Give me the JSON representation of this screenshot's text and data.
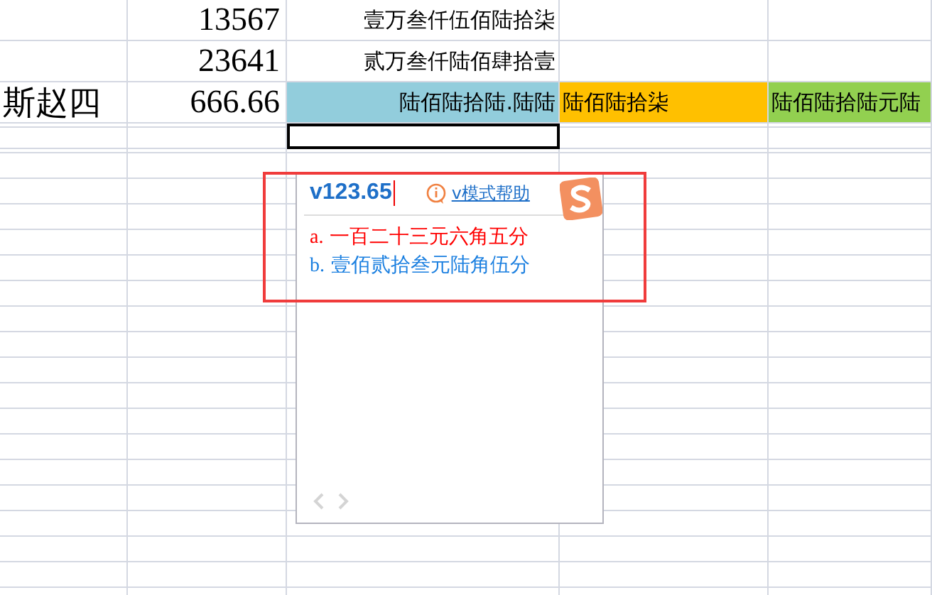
{
  "sheet": {
    "rows": [
      {
        "cells": [
          {
            "selected": false
          },
          {
            "text": "13567",
            "selected": false
          },
          {
            "text": "壹万叁仟伍佰陆拾柒",
            "selected": false
          },
          {
            "selected": false
          },
          {
            "selected": false
          }
        ]
      },
      {
        "cells": [
          {
            "selected": false
          },
          {
            "text": "23641",
            "selected": false
          },
          {
            "text": "贰万叁仟陆佰肆拾壹",
            "selected": false
          },
          {
            "selected": false
          },
          {
            "selected": false
          }
        ]
      },
      {
        "cells": [
          {
            "text": "斯赵四",
            "selected": false
          },
          {
            "text": "666.66",
            "selected": false
          },
          {
            "text": "陆佰陆拾陆.陆陆",
            "color": "#92cddc",
            "selected": false
          },
          {
            "text": "陆佰陆拾柒",
            "color": "#ffc000",
            "selected": false
          },
          {
            "text": "陆佰陆拾陆元陆",
            "color": "#92d050",
            "selected": false
          }
        ]
      },
      {
        "cells": [
          {
            "selected": false
          },
          {
            "selected": false
          },
          {
            "selected": true
          },
          {
            "selected": false
          },
          {
            "selected": false
          }
        ]
      }
    ]
  },
  "ime_popup": {
    "input": "v123.65",
    "help_link": "v模式帮助",
    "candidates": [
      {
        "label": "a.",
        "text": "一百二十三元六角五分",
        "selected": true
      },
      {
        "label": "b.",
        "text": "壹佰贰拾叁元陆角伍分",
        "selected": false
      }
    ]
  }
}
